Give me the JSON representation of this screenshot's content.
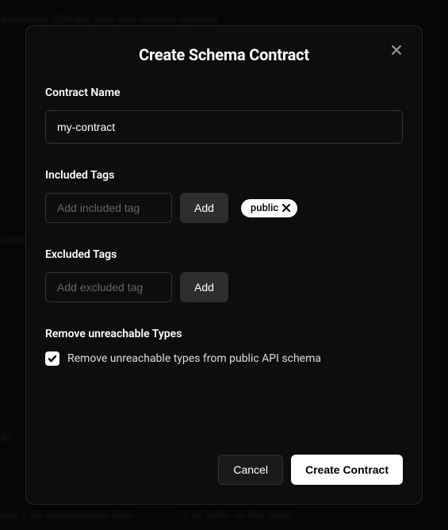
{
  "modal": {
    "title": "Create Schema Contract",
    "contractName": {
      "label": "Contract Name",
      "value": "my-contract"
    },
    "includedTags": {
      "label": "Included Tags",
      "placeholder": "Add included tag",
      "addButton": "Add",
      "tags": [
        "public"
      ]
    },
    "excludedTags": {
      "label": "Excluded Tags",
      "placeholder": "Add excluded tag",
      "addButton": "Add"
    },
    "removeUnreachable": {
      "label": "Remove unreachable Types",
      "checkboxLabel": "Remove unreachable types from public API schema",
      "checked": true
    },
    "footer": {
      "cancel": "Cancel",
      "submit": "Create Contract"
    }
  }
}
